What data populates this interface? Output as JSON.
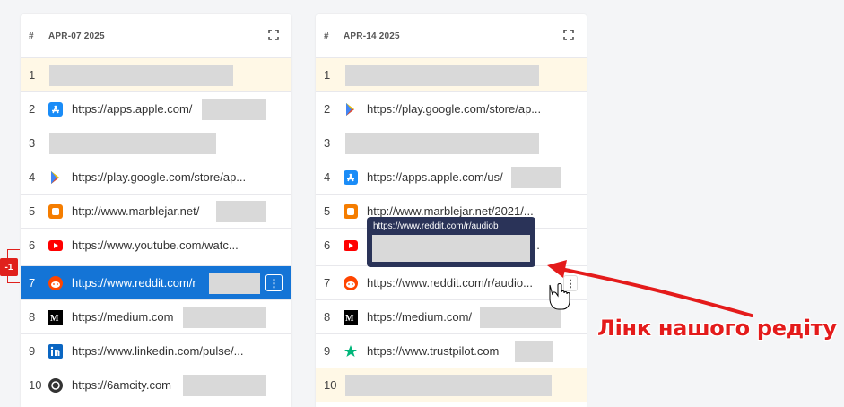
{
  "panels": [
    {
      "date": "APR-07 2025",
      "hash": "#",
      "rows": [
        {
          "num": "1",
          "icon": "",
          "url": ""
        },
        {
          "num": "2",
          "icon": "app-store-icon",
          "url": "https://apps.apple.com/"
        },
        {
          "num": "3",
          "icon": "",
          "url": ""
        },
        {
          "num": "4",
          "icon": "google-play-icon",
          "url": "https://play.google.com/store/ap..."
        },
        {
          "num": "5",
          "icon": "blogger-icon",
          "url": "http://www.marblejar.net/"
        },
        {
          "num": "6",
          "icon": "youtube-icon",
          "url": "https://www.youtube.com/watc..."
        },
        {
          "num": "7",
          "icon": "reddit-icon",
          "url": "https://www.reddit.com/r"
        },
        {
          "num": "8",
          "icon": "medium-icon",
          "url": "https://medium.com"
        },
        {
          "num": "9",
          "icon": "linkedin-icon",
          "url": "https://www.linkedin.com/pulse/..."
        },
        {
          "num": "10",
          "icon": "6amcity-icon",
          "url": "https://6amcity.com"
        }
      ]
    },
    {
      "date": "APR-14 2025",
      "hash": "#",
      "rows": [
        {
          "num": "1",
          "icon": "",
          "url": ""
        },
        {
          "num": "2",
          "icon": "google-play-icon",
          "url": "https://play.google.com/store/ap..."
        },
        {
          "num": "3",
          "icon": "",
          "url": ""
        },
        {
          "num": "4",
          "icon": "app-store-icon",
          "url": "https://apps.apple.com/us/"
        },
        {
          "num": "5",
          "icon": "blogger-icon",
          "url": "http://www.marblejar.net/2021/..."
        },
        {
          "num": "6",
          "icon": "youtube-icon",
          "url": "..."
        },
        {
          "num": "7",
          "icon": "reddit-icon",
          "url": "https://www.reddit.com/r/audio..."
        },
        {
          "num": "8",
          "icon": "medium-icon",
          "url": "https://medium.com/"
        },
        {
          "num": "9",
          "icon": "trustpilot-icon",
          "url": "https://www.trustpilot.com"
        },
        {
          "num": "10",
          "icon": "",
          "url": ""
        }
      ]
    }
  ],
  "tooltip": {
    "text": "https://www.reddit.com/r/audiob"
  },
  "rank_change": "-1",
  "kebab": "⋮",
  "annotation": {
    "text": "Лінк нашого редіту"
  },
  "colors": {
    "selected": "#1474d6",
    "highlight": "#fff8e6",
    "accent_red": "#e41b1b",
    "tooltip_bg": "#2a3358"
  }
}
